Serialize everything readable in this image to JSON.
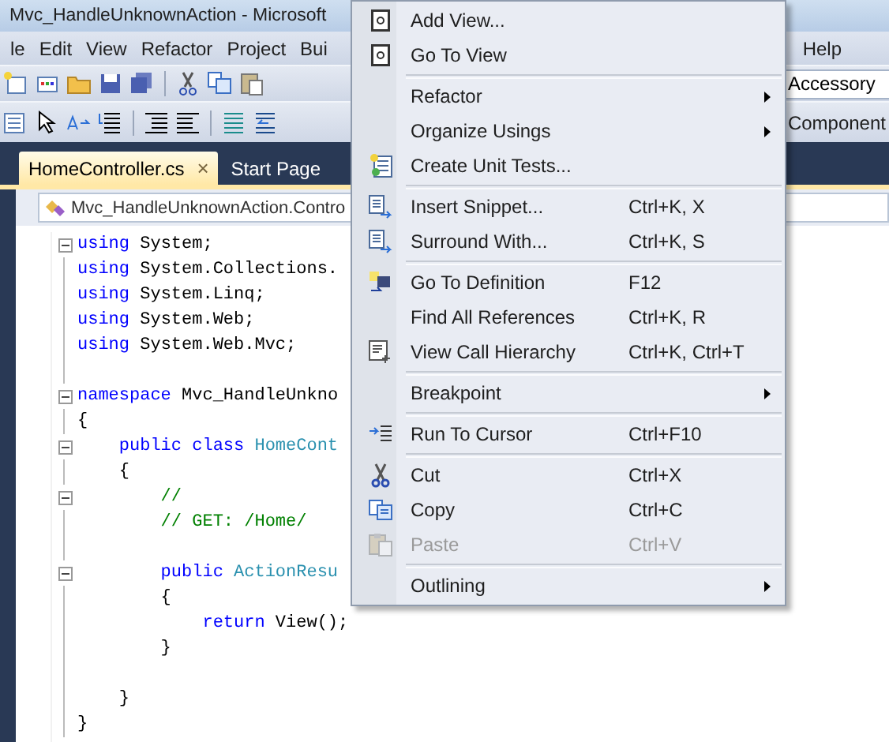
{
  "window": {
    "title": "Mvc_HandleUnknownAction - Microsoft"
  },
  "menu_bar": {
    "left": [
      "le",
      "Edit",
      "View",
      "Refactor",
      "Project",
      "Bui"
    ],
    "right": [
      "Help"
    ]
  },
  "toolbar": {
    "field_value": "Accessory"
  },
  "toolbar_2": {
    "right_label": "Component"
  },
  "tabs": [
    {
      "label": "HomeController.cs",
      "selected": true,
      "close": "×"
    },
    {
      "label": "Start Page",
      "selected": false
    }
  ],
  "navigation": {
    "type_combo": "Mvc_HandleUnknownAction.Contro"
  },
  "code": [
    {
      "fold": true,
      "tokens": [
        {
          "text": "using",
          "kind": "keyword"
        },
        {
          "text": " System;",
          "kind": "plain"
        }
      ]
    },
    {
      "fold": false,
      "tokens": [
        {
          "text": "using",
          "kind": "keyword"
        },
        {
          "text": " System.Collections.",
          "kind": "plain"
        }
      ]
    },
    {
      "fold": false,
      "tokens": [
        {
          "text": "using",
          "kind": "keyword"
        },
        {
          "text": " System.Linq;",
          "kind": "plain"
        }
      ]
    },
    {
      "fold": false,
      "tokens": [
        {
          "text": "using",
          "kind": "keyword"
        },
        {
          "text": " System.Web;",
          "kind": "plain"
        }
      ]
    },
    {
      "fold": false,
      "tokens": [
        {
          "text": "using",
          "kind": "keyword"
        },
        {
          "text": " System.Web.Mvc;",
          "kind": "plain"
        }
      ]
    },
    {
      "fold": false
    },
    {
      "fold": true,
      "tokens": [
        {
          "text": "namespace",
          "kind": "keyword"
        },
        {
          "text": " Mvc_HandleUnkno",
          "kind": "plain"
        }
      ]
    },
    {
      "fold": false,
      "tokens": [
        {
          "text": "{",
          "kind": "plain"
        }
      ]
    },
    {
      "fold": true,
      "tokens": [
        {
          "text": "    public class",
          "kind": "keyword"
        },
        {
          "text": " HomeCont",
          "kind": "type"
        }
      ]
    },
    {
      "fold": false,
      "tokens": [
        {
          "text": "    {",
          "kind": "plain"
        }
      ]
    },
    {
      "fold": true,
      "tokens": [
        {
          "text": "        //",
          "kind": "comment"
        }
      ]
    },
    {
      "fold": false,
      "tokens": [
        {
          "text": "        // GET: /Home/",
          "kind": "comment"
        }
      ]
    },
    {
      "fold": false
    },
    {
      "fold": true,
      "tokens": [
        {
          "text": "        public",
          "kind": "keyword"
        },
        {
          "text": " ActionResu",
          "kind": "type"
        }
      ]
    },
    {
      "fold": false,
      "tokens": [
        {
          "text": "        {",
          "kind": "plain"
        }
      ]
    },
    {
      "fold": false,
      "tokens": [
        {
          "text": "            return",
          "kind": "keyword"
        },
        {
          "text": " View();",
          "kind": "plain"
        }
      ]
    },
    {
      "fold": false,
      "tokens": [
        {
          "text": "        }",
          "kind": "plain"
        }
      ]
    },
    {
      "fold": false
    },
    {
      "fold": false,
      "tokens": [
        {
          "text": "    }",
          "kind": "plain"
        }
      ]
    },
    {
      "fold": false,
      "tokens": [
        {
          "text": "}",
          "kind": "plain"
        }
      ]
    }
  ],
  "context_menu": {
    "groups": [
      [
        {
          "label": "Add View...",
          "kind": "view",
          "submenu": false,
          "disabled": false
        },
        {
          "label": "Go To View",
          "kind": "view",
          "submenu": false,
          "disabled": false
        }
      ],
      [
        {
          "label": "Refactor",
          "kind": "plain",
          "submenu": true,
          "disabled": false
        },
        {
          "label": "Organize Usings",
          "kind": "plain",
          "submenu": true,
          "disabled": false
        },
        {
          "label": "Create Unit Tests...",
          "kind": "unit-test",
          "submenu": false,
          "disabled": false
        }
      ],
      [
        {
          "label": "Insert Snippet...",
          "shortcut": "Ctrl+K, X",
          "kind": "snippet",
          "submenu": false,
          "disabled": false
        },
        {
          "label": "Surround With...",
          "shortcut": "Ctrl+K, S",
          "kind": "snippet",
          "submenu": false,
          "disabled": false
        }
      ],
      [
        {
          "label": "Go To Definition",
          "shortcut": "F12",
          "kind": "definition",
          "submenu": false,
          "disabled": false
        },
        {
          "label": "Find All References",
          "shortcut": "Ctrl+K, R",
          "kind": "plain",
          "submenu": false,
          "disabled": false
        },
        {
          "label": "View Call Hierarchy",
          "shortcut": "Ctrl+K, Ctrl+T",
          "kind": "hierarchy",
          "submenu": false,
          "disabled": false
        }
      ],
      [
        {
          "label": "Breakpoint",
          "kind": "plain",
          "submenu": true,
          "disabled": false
        }
      ],
      [
        {
          "label": "Run To Cursor",
          "shortcut": "Ctrl+F10",
          "kind": "run-cursor",
          "submenu": false,
          "disabled": false
        }
      ],
      [
        {
          "label": "Cut",
          "shortcut": "Ctrl+X",
          "kind": "cut",
          "submenu": false,
          "disabled": false
        },
        {
          "label": "Copy",
          "shortcut": "Ctrl+C",
          "kind": "copy",
          "submenu": false,
          "disabled": false
        },
        {
          "label": "Paste",
          "shortcut": "Ctrl+V",
          "kind": "paste",
          "submenu": false,
          "disabled": true
        }
      ],
      [
        {
          "label": "Outlining",
          "kind": "plain",
          "submenu": true,
          "disabled": false
        }
      ]
    ]
  }
}
